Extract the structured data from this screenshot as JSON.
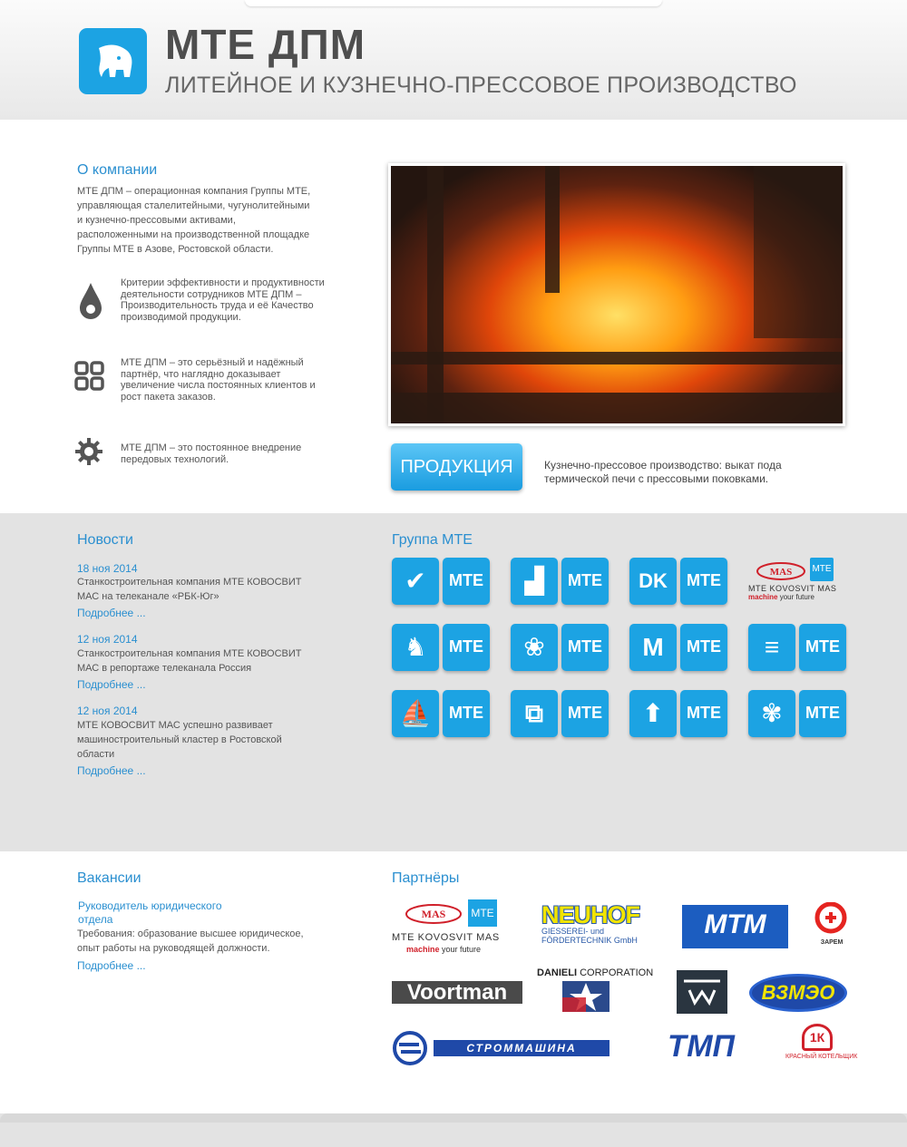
{
  "header": {
    "title": "МТЕ ДПМ",
    "subtitle": "ЛИТЕЙНОЕ И КУЗНЕЧНО-ПРЕССОВОЕ ПРОИЗВОДСТВО"
  },
  "about": {
    "heading": "О компании",
    "text": "МТЕ ДПМ – операционная компания Группы МТЕ, управляющая сталелитейными, чугунолитейными и кузнечно-прессовыми активами, расположенными на производственной площадке Группы МТЕ в Азове, Ростовской области.",
    "features": [
      {
        "icon": "drop-icon",
        "text": "Критерии эффективности и продуктивности деятельности сотрудников МТЕ ДПМ – Производительность труда и её Качество производимой продукции."
      },
      {
        "icon": "grid-icon",
        "text": "МТЕ ДПМ – это серьёзный и надёжный партнёр, что наглядно доказывает увеличение числа постоянных клиентов и рост пакета заказов."
      },
      {
        "icon": "gear-icon",
        "text": "МТЕ ДПМ – это постоянное внедрение передовых технологий."
      }
    ]
  },
  "products": {
    "button": "ПРОДУКЦИЯ",
    "caption": "Кузнечно-прессовое производство: выкат пода термической печи с прессовыми поковками."
  },
  "news": {
    "heading": "Новости",
    "items": [
      {
        "date": "18 ноя 2014",
        "text": "Станкостроительная компания МТЕ КОВОСВИТ МАС на телеканале «РБК-Юг»",
        "more": "Подробнее ..."
      },
      {
        "date": "12 ноя 2014",
        "text": "Станкостроительная компания МТЕ КОВОСВИТ МАС в репортаже телеканала Россия",
        "more": "Подробнее ..."
      },
      {
        "date": "12 ноя 2014",
        "text": "МТЕ КОВОСВИТ МАС успешно развивает машиностроительный кластер в Ростовской области",
        "more": "Подробнее ..."
      }
    ]
  },
  "group": {
    "heading": "Группа МТЕ",
    "brand": "МТЕ",
    "tiles": [
      {
        "icon": "check-icon",
        "glyph": "✔"
      },
      {
        "icon": "stairs-icon",
        "glyph": "▟"
      },
      {
        "icon": "dk-icon",
        "glyph": "DK"
      },
      {
        "icon": "elephant-icon",
        "glyph": "♞"
      },
      {
        "icon": "circles-icon",
        "glyph": "❀"
      },
      {
        "icon": "m-icon",
        "glyph": "M"
      },
      {
        "icon": "sd-icon",
        "glyph": "≡"
      },
      {
        "icon": "sail-icon",
        "glyph": "⛵"
      },
      {
        "icon": "squares-icon",
        "glyph": "⧉"
      },
      {
        "icon": "arrow-up-icon",
        "glyph": "⬆"
      },
      {
        "icon": "butterfly-icon",
        "glyph": "✾"
      }
    ],
    "kovosvit": {
      "mark": "MAS",
      "mte": "МТЕ",
      "name": "MTE KOVOSVIT MAS",
      "tagline1": "machine",
      "tagline2": "your future"
    }
  },
  "vacancies": {
    "heading": "Вакансии",
    "title": "Руководитель юридического отдела",
    "text": "Требования: образование высшее юридическое, опыт работы на руководящей должности.",
    "more": "Подробнее ..."
  },
  "partners": {
    "heading": "Партнёры",
    "kovosvit": {
      "mark": "MAS",
      "mte": "МТЕ",
      "name": "MTE KOVOSVIT MAS",
      "tagline1": "machine",
      "tagline2": "your future"
    },
    "neuhof": {
      "name": "NEUHOF",
      "line1": "GIESSEREI- und",
      "line2": "FÖRDERTECHNIK GmbH"
    },
    "mtm": {
      "name": "MTM"
    },
    "zarem": {
      "name": "ЗАРЕМ"
    },
    "voortman": {
      "name": "Voortman"
    },
    "danieli": {
      "name1": "DANIELI",
      "name2": "CORPORATION"
    },
    "vzmeo": {
      "name": "ВЗМЭО"
    },
    "strommashina": {
      "name": "СТРОММАШИНА"
    },
    "tmp": {
      "name": "ТМП"
    },
    "kotelshik": {
      "mark": "1К",
      "name": "КРАСНЫЙ КОТЕЛЬЩИК"
    }
  },
  "colors": {
    "accent": "#1ca3e3",
    "link": "#2a8fd0",
    "grey_band": "#e3e3e3"
  }
}
